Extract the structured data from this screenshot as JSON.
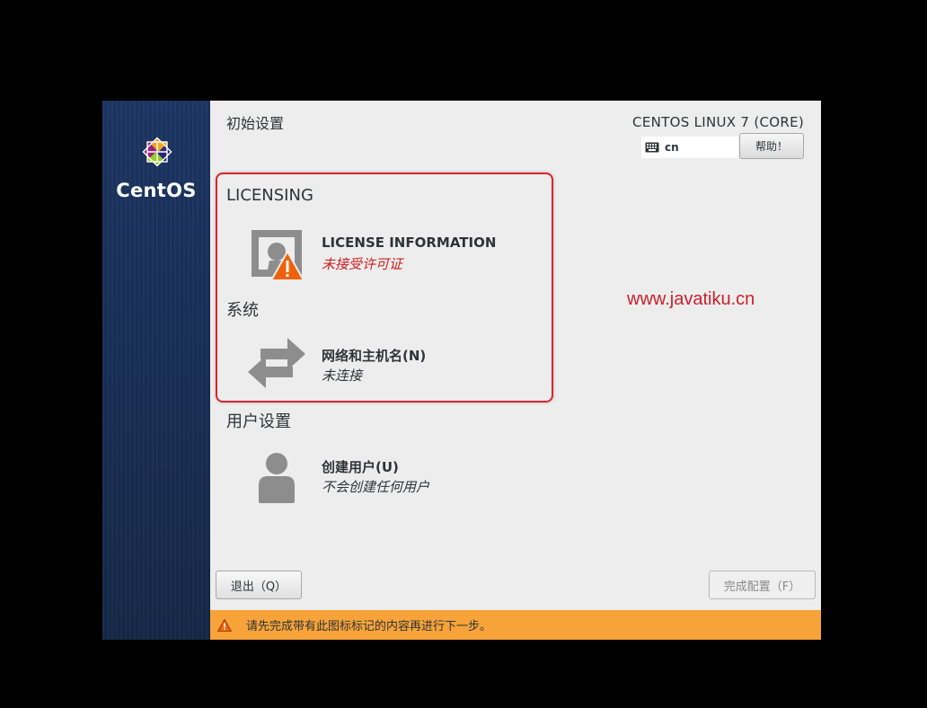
{
  "sidebar": {
    "brand": "CentOS"
  },
  "header": {
    "title": "初始设置",
    "product": "CENTOS LINUX 7 (CORE)",
    "keyboard_layout": "cn",
    "help_label": "帮助！"
  },
  "sections": [
    {
      "label": "LICENSING",
      "spokes": [
        {
          "title": "LICENSE INFORMATION",
          "status": "未接受许可证",
          "icon": "license-warning-icon"
        }
      ]
    },
    {
      "label": "系统",
      "spokes": [
        {
          "title": "网络和主机名(N)",
          "status": "未连接",
          "icon": "network-arrows-icon"
        }
      ]
    },
    {
      "label": "用户设置",
      "spokes": [
        {
          "title": "创建用户(U)",
          "status": "不会创建任何用户",
          "icon": "user-icon"
        }
      ]
    }
  ],
  "watermark": "www.javatiku.cn",
  "footer": {
    "quit_label": "退出（Q）",
    "finish_label": "完成配置（F）",
    "warning_text": "请先完成带有此图标标记的内容再进行下一步。"
  },
  "colors": {
    "sidebar": "#1c3563",
    "warning_bar": "#f7a33a",
    "warning_text": "#cc1f1f",
    "highlight_border": "#d9262c",
    "warning_icon": "#f0620a"
  }
}
